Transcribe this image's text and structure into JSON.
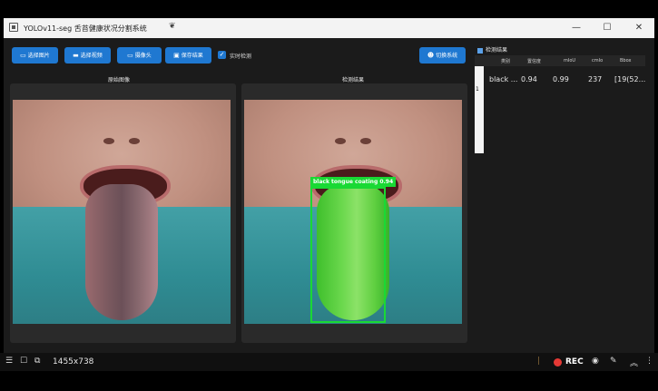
{
  "window": {
    "title": "YOLOv11-seg 舌苔健康状况分割系统"
  },
  "toolbar": {
    "select_image": "选择图片",
    "select_video": "选择视频",
    "camera": "摄像头",
    "save_results": "保存结果",
    "realtime_detect": "实时检测",
    "switch_model": "切换系统"
  },
  "panels": {
    "original": "原始图像",
    "result": "检测结果"
  },
  "detection": {
    "label": "black tongue coating  0.94"
  },
  "results": {
    "header": "检测结果",
    "columns": [
      "类别",
      "置信度",
      "mIoU",
      "cmIo",
      "Bbox"
    ],
    "rows": [
      {
        "index": "1",
        "class": "black ...",
        "conf": "0.94",
        "miou": "0.99",
        "cmio": "237",
        "bbox": "[19(52..."
      }
    ]
  },
  "statusbar": {
    "resolution": "1455x738",
    "rec": "REC"
  }
}
